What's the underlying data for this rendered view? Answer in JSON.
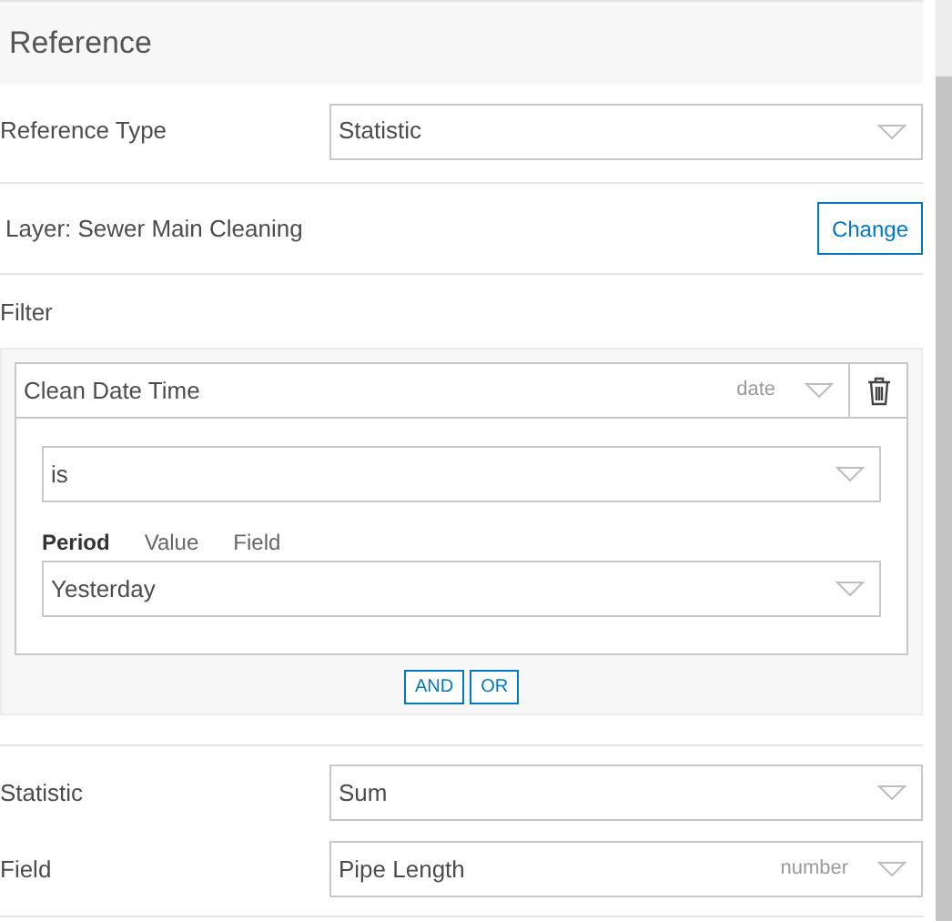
{
  "header": {
    "title": "Reference"
  },
  "reference_type": {
    "label": "Reference Type",
    "value": "Statistic"
  },
  "layer": {
    "label": "Layer: Sewer Main Cleaning",
    "button": "Change"
  },
  "filter": {
    "label": "Filter",
    "field": {
      "value": "Clean Date Time",
      "type": "date"
    },
    "operator": {
      "value": "is"
    },
    "value_tabs": [
      {
        "label": "Period",
        "selected": true
      },
      {
        "label": "Value",
        "selected": false
      },
      {
        "label": "Field",
        "selected": false
      }
    ],
    "period": {
      "value": "Yesterday"
    },
    "logic_buttons": [
      "AND",
      "OR"
    ]
  },
  "statistic": {
    "label": "Statistic",
    "value": "Sum"
  },
  "field": {
    "label": "Field",
    "value": "Pipe Length",
    "type": "number"
  }
}
